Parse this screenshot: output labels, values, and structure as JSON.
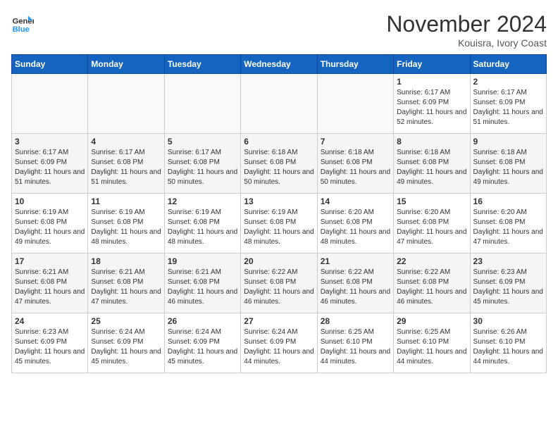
{
  "header": {
    "logo_line1": "General",
    "logo_line2": "Blue",
    "month_year": "November 2024",
    "location": "Kouisra, Ivory Coast"
  },
  "days_of_week": [
    "Sunday",
    "Monday",
    "Tuesday",
    "Wednesday",
    "Thursday",
    "Friday",
    "Saturday"
  ],
  "weeks": [
    [
      {
        "day": "",
        "info": ""
      },
      {
        "day": "",
        "info": ""
      },
      {
        "day": "",
        "info": ""
      },
      {
        "day": "",
        "info": ""
      },
      {
        "day": "",
        "info": ""
      },
      {
        "day": "1",
        "info": "Sunrise: 6:17 AM\nSunset: 6:09 PM\nDaylight: 11 hours and 52 minutes."
      },
      {
        "day": "2",
        "info": "Sunrise: 6:17 AM\nSunset: 6:09 PM\nDaylight: 11 hours and 51 minutes."
      }
    ],
    [
      {
        "day": "3",
        "info": "Sunrise: 6:17 AM\nSunset: 6:09 PM\nDaylight: 11 hours and 51 minutes."
      },
      {
        "day": "4",
        "info": "Sunrise: 6:17 AM\nSunset: 6:08 PM\nDaylight: 11 hours and 51 minutes."
      },
      {
        "day": "5",
        "info": "Sunrise: 6:17 AM\nSunset: 6:08 PM\nDaylight: 11 hours and 50 minutes."
      },
      {
        "day": "6",
        "info": "Sunrise: 6:18 AM\nSunset: 6:08 PM\nDaylight: 11 hours and 50 minutes."
      },
      {
        "day": "7",
        "info": "Sunrise: 6:18 AM\nSunset: 6:08 PM\nDaylight: 11 hours and 50 minutes."
      },
      {
        "day": "8",
        "info": "Sunrise: 6:18 AM\nSunset: 6:08 PM\nDaylight: 11 hours and 49 minutes."
      },
      {
        "day": "9",
        "info": "Sunrise: 6:18 AM\nSunset: 6:08 PM\nDaylight: 11 hours and 49 minutes."
      }
    ],
    [
      {
        "day": "10",
        "info": "Sunrise: 6:19 AM\nSunset: 6:08 PM\nDaylight: 11 hours and 49 minutes."
      },
      {
        "day": "11",
        "info": "Sunrise: 6:19 AM\nSunset: 6:08 PM\nDaylight: 11 hours and 48 minutes."
      },
      {
        "day": "12",
        "info": "Sunrise: 6:19 AM\nSunset: 6:08 PM\nDaylight: 11 hours and 48 minutes."
      },
      {
        "day": "13",
        "info": "Sunrise: 6:19 AM\nSunset: 6:08 PM\nDaylight: 11 hours and 48 minutes."
      },
      {
        "day": "14",
        "info": "Sunrise: 6:20 AM\nSunset: 6:08 PM\nDaylight: 11 hours and 48 minutes."
      },
      {
        "day": "15",
        "info": "Sunrise: 6:20 AM\nSunset: 6:08 PM\nDaylight: 11 hours and 47 minutes."
      },
      {
        "day": "16",
        "info": "Sunrise: 6:20 AM\nSunset: 6:08 PM\nDaylight: 11 hours and 47 minutes."
      }
    ],
    [
      {
        "day": "17",
        "info": "Sunrise: 6:21 AM\nSunset: 6:08 PM\nDaylight: 11 hours and 47 minutes."
      },
      {
        "day": "18",
        "info": "Sunrise: 6:21 AM\nSunset: 6:08 PM\nDaylight: 11 hours and 47 minutes."
      },
      {
        "day": "19",
        "info": "Sunrise: 6:21 AM\nSunset: 6:08 PM\nDaylight: 11 hours and 46 minutes."
      },
      {
        "day": "20",
        "info": "Sunrise: 6:22 AM\nSunset: 6:08 PM\nDaylight: 11 hours and 46 minutes."
      },
      {
        "day": "21",
        "info": "Sunrise: 6:22 AM\nSunset: 6:08 PM\nDaylight: 11 hours and 46 minutes."
      },
      {
        "day": "22",
        "info": "Sunrise: 6:22 AM\nSunset: 6:08 PM\nDaylight: 11 hours and 46 minutes."
      },
      {
        "day": "23",
        "info": "Sunrise: 6:23 AM\nSunset: 6:09 PM\nDaylight: 11 hours and 45 minutes."
      }
    ],
    [
      {
        "day": "24",
        "info": "Sunrise: 6:23 AM\nSunset: 6:09 PM\nDaylight: 11 hours and 45 minutes."
      },
      {
        "day": "25",
        "info": "Sunrise: 6:24 AM\nSunset: 6:09 PM\nDaylight: 11 hours and 45 minutes."
      },
      {
        "day": "26",
        "info": "Sunrise: 6:24 AM\nSunset: 6:09 PM\nDaylight: 11 hours and 45 minutes."
      },
      {
        "day": "27",
        "info": "Sunrise: 6:24 AM\nSunset: 6:09 PM\nDaylight: 11 hours and 44 minutes."
      },
      {
        "day": "28",
        "info": "Sunrise: 6:25 AM\nSunset: 6:10 PM\nDaylight: 11 hours and 44 minutes."
      },
      {
        "day": "29",
        "info": "Sunrise: 6:25 AM\nSunset: 6:10 PM\nDaylight: 11 hours and 44 minutes."
      },
      {
        "day": "30",
        "info": "Sunrise: 6:26 AM\nSunset: 6:10 PM\nDaylight: 11 hours and 44 minutes."
      }
    ]
  ]
}
